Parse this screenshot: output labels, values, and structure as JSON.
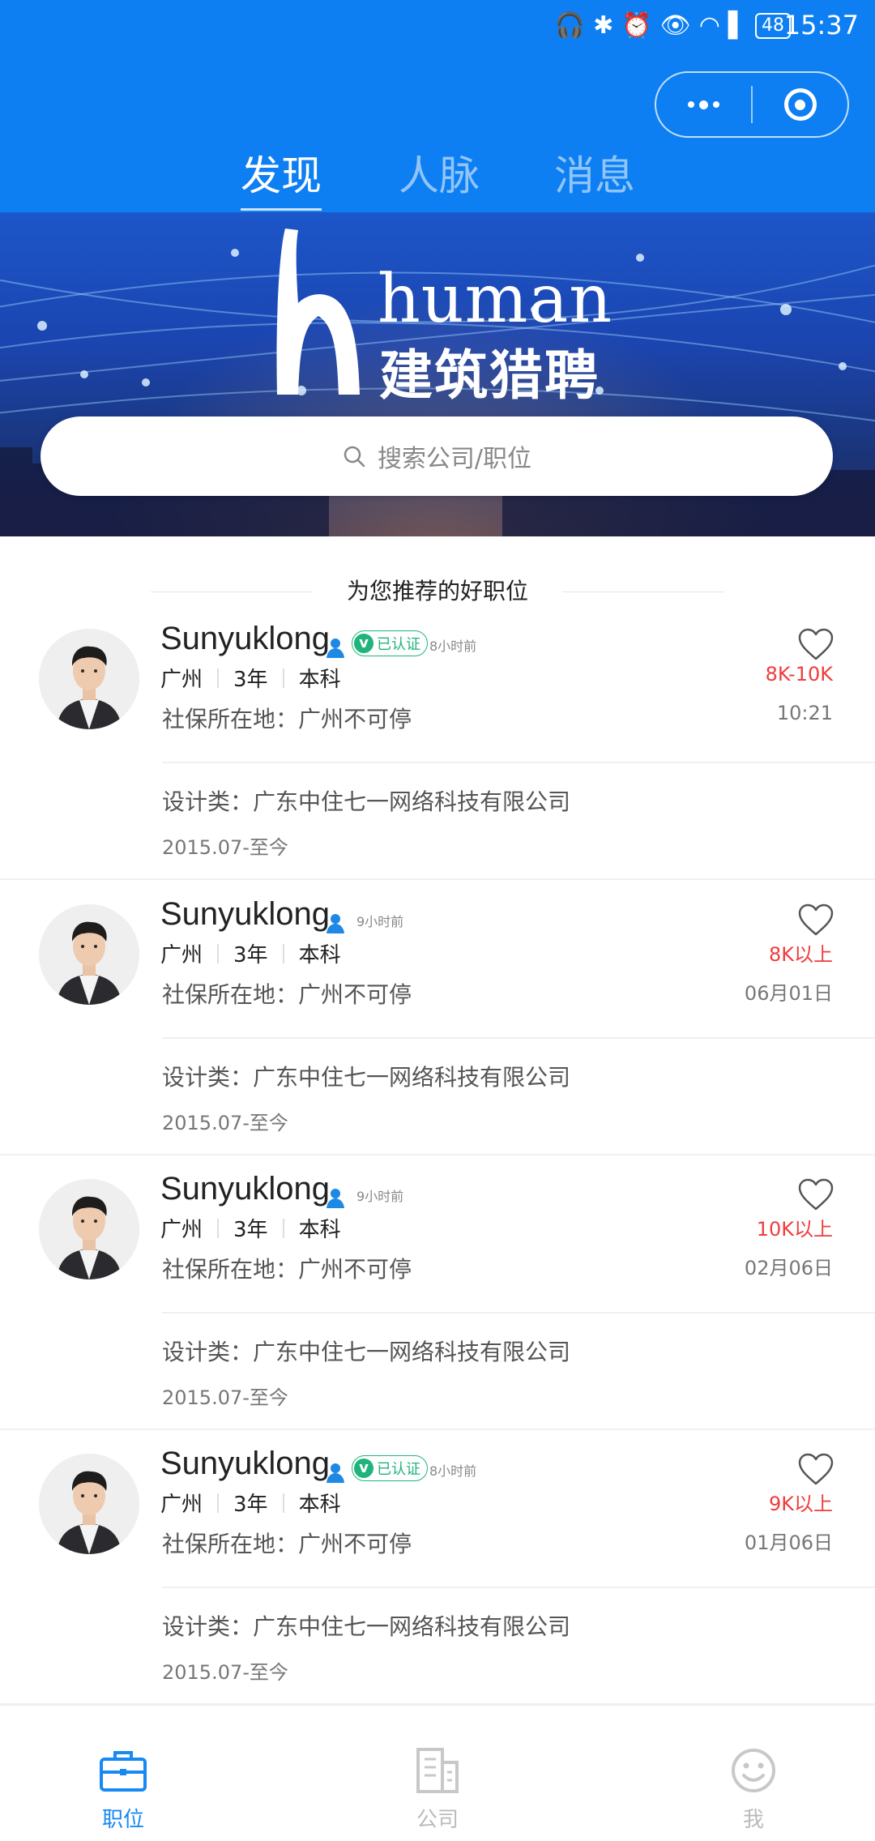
{
  "status": {
    "time": "15:37",
    "battery": "48"
  },
  "tabs": [
    {
      "label": "发现",
      "active": true
    },
    {
      "label": "人脉",
      "active": false
    },
    {
      "label": "消息",
      "active": false
    }
  ],
  "banner": {
    "brand": "human",
    "brand_cn": "建筑猎聘"
  },
  "search": {
    "placeholder": "搜索公司/职位"
  },
  "section_title": "为您推荐的好职位",
  "cards": [
    {
      "name": "Sunyuklong",
      "verified": true,
      "verified_label": "已认证",
      "time_ago": "8小时前",
      "city": "广州",
      "years": "3年",
      "degree": "本科",
      "salary": "8K-10K",
      "social": "社保所在地：广州不可停",
      "date": "10:21",
      "company": "设计类：广东中住七一网络科技有限公司",
      "period": "2015.07-至今"
    },
    {
      "name": "Sunyuklong",
      "verified": false,
      "verified_label": "",
      "time_ago": "9小时前",
      "city": "广州",
      "years": "3年",
      "degree": "本科",
      "salary": "8K以上",
      "social": "社保所在地：广州不可停",
      "date": "06月01日",
      "company": "设计类：广东中住七一网络科技有限公司",
      "period": "2015.07-至今"
    },
    {
      "name": "Sunyuklong",
      "verified": false,
      "verified_label": "",
      "time_ago": "9小时前",
      "city": "广州",
      "years": "3年",
      "degree": "本科",
      "salary": "10K以上",
      "social": "社保所在地：广州不可停",
      "date": "02月06日",
      "company": "设计类：广东中住七一网络科技有限公司",
      "period": "2015.07-至今"
    },
    {
      "name": "Sunyuklong",
      "verified": true,
      "verified_label": "已认证",
      "time_ago": "8小时前",
      "city": "广州",
      "years": "3年",
      "degree": "本科",
      "salary": "9K以上",
      "social": "社保所在地：广州不可停",
      "date": "01月06日",
      "company": "设计类：广东中住七一网络科技有限公司",
      "period": "2015.07-至今"
    }
  ],
  "bottom_nav": [
    {
      "label": "职位",
      "icon": "briefcase-icon",
      "active": true
    },
    {
      "label": "公司",
      "icon": "building-icon",
      "active": false
    },
    {
      "label": "我",
      "icon": "smiley-icon",
      "active": false
    }
  ],
  "colors": {
    "primary": "#0d7ff2",
    "salary": "#f03c3c",
    "verified": "#20b47c",
    "nav_active": "#1689f2"
  }
}
